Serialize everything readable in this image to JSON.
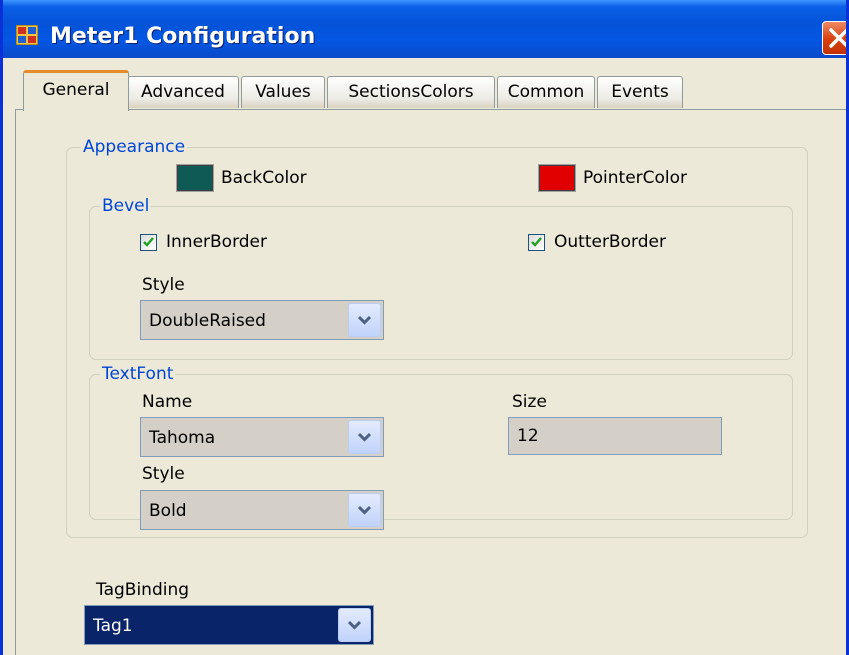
{
  "window": {
    "title": "Meter1 Configuration",
    "title_bar_color": "#0453d9",
    "close_button_color": "#d83f0c"
  },
  "tabs": [
    {
      "label": "General",
      "active": true
    },
    {
      "label": "Advanced",
      "active": false
    },
    {
      "label": "Values",
      "active": false
    },
    {
      "label": "SectionsColors",
      "active": false
    },
    {
      "label": "Common",
      "active": false
    },
    {
      "label": "Events",
      "active": false
    }
  ],
  "appearance": {
    "legend": "Appearance",
    "back_color_label": "BackColor",
    "back_color": "#0f5a55",
    "pointer_color_label": "PointerColor",
    "pointer_color": "#e00000"
  },
  "bevel": {
    "legend": "Bevel",
    "inner_border_label": "InnerBorder",
    "inner_border_checked": true,
    "outer_border_label": "OutterBorder",
    "outer_border_checked": true,
    "style_label": "Style",
    "style_value": "DoubleRaised"
  },
  "text_font": {
    "legend": "TextFont",
    "name_label": "Name",
    "name_value": "Tahoma",
    "size_label": "Size",
    "size_value": "12",
    "style_label": "Style",
    "style_value": "Bold"
  },
  "tag_binding": {
    "label": "TagBinding",
    "value": "Tag1"
  }
}
